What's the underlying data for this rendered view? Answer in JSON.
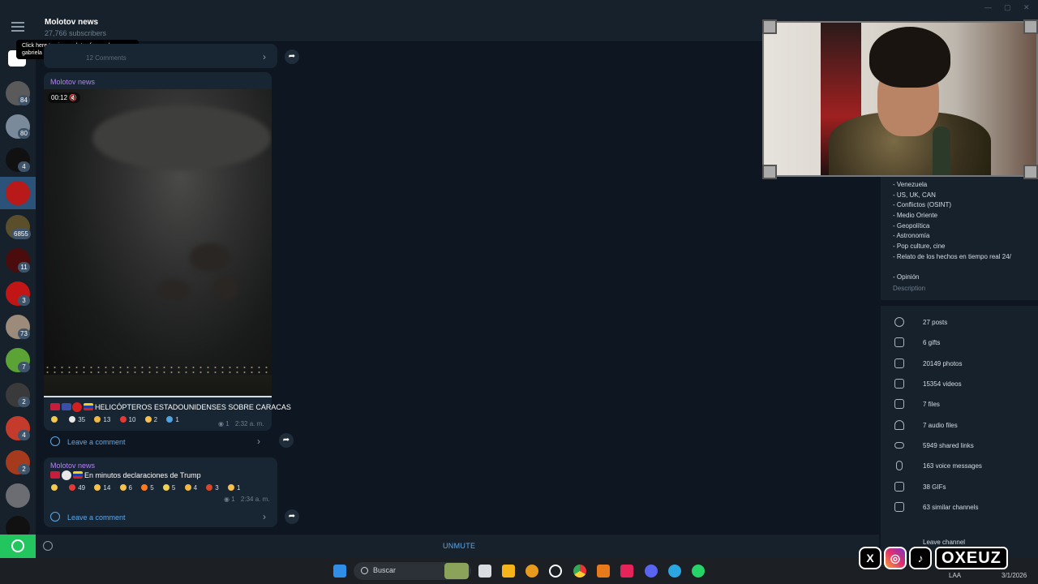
{
  "header": {
    "channel_name": "Molotov news",
    "subscribers": "27,766 subscribers"
  },
  "tooltip": {
    "text": "Click here to view updates from val, gabriela paola and Lesmen.",
    "close_icon": "close-icon"
  },
  "sidebar": {
    "badges": [
      "84",
      "80",
      "4",
      "6855",
      "11",
      "3",
      "73",
      "7",
      "2",
      "4",
      "2"
    ]
  },
  "messages": [
    {
      "comments_label": "12 Comments"
    },
    {
      "author": "Molotov news",
      "video_time": "00:12",
      "video_progress_percent": 100,
      "caption": "HELICÓPTEROS ESTADOUNIDENSES SOBRE CARACAS",
      "reactions": [
        {
          "icon": "star-icon",
          "count": ""
        },
        {
          "icon": "eyes-icon",
          "count": "35"
        },
        {
          "icon": "ghost-icon",
          "count": "13"
        },
        {
          "icon": "heart-icon",
          "count": "10"
        },
        {
          "icon": "clap-icon",
          "count": "2"
        },
        {
          "icon": "whale-icon",
          "count": "1"
        }
      ],
      "views": "1",
      "time": "2:32 a. m.",
      "comment_label": "Leave a comment"
    },
    {
      "author": "Molotov news",
      "text": "En minutos declaraciones de Trump",
      "reactions": [
        {
          "icon": "star-icon",
          "count": ""
        },
        {
          "icon": "heart-icon",
          "count": "49"
        },
        {
          "icon": "smile-icon",
          "count": "14"
        },
        {
          "icon": "cry-icon",
          "count": "6"
        },
        {
          "icon": "fire-icon",
          "count": "5"
        },
        {
          "icon": "party-icon",
          "count": "5"
        },
        {
          "icon": "scream-icon",
          "count": "4"
        },
        {
          "icon": "angry-icon",
          "count": "3"
        },
        {
          "icon": "thumbs-up-icon",
          "count": "1"
        }
      ],
      "views": "1",
      "time": "2:34 a. m.",
      "comment_label": "Leave a comment"
    }
  ],
  "bottombar": {
    "unmute_label": "UNMUTE"
  },
  "info_panel": {
    "description_lines": [
      "- Venezuela",
      "- US, UK, CAN",
      "- Conflictos (OSINT)",
      "- Medio Oriente",
      "- Geopolítica",
      "- Astronomía",
      "- Pop culture, cine",
      "- Relato de los hechos en tiempo real 24/",
      "",
      "- Opinión"
    ],
    "description_label": "Description",
    "stats": [
      {
        "icon": "posts-icon",
        "label": "27 posts"
      },
      {
        "icon": "gift-icon",
        "label": "6 gifts"
      },
      {
        "icon": "photo-icon",
        "label": "20149 photos"
      },
      {
        "icon": "video-icon",
        "label": "15354 videos"
      },
      {
        "icon": "file-icon",
        "label": "7 files"
      },
      {
        "icon": "headphones-icon",
        "label": "7 audio files"
      },
      {
        "icon": "link-icon",
        "label": "5949 shared links"
      },
      {
        "icon": "mic-icon",
        "label": "163 voice messages"
      },
      {
        "icon": "gif-icon",
        "label": "38 GIFs"
      },
      {
        "icon": "megaphone-icon",
        "label": "63 similar channels"
      }
    ],
    "leave_label": "Leave channel"
  },
  "taskbar": {
    "search_placeholder": "Buscar",
    "lang": "LAA",
    "date": "3/1/2026"
  },
  "overlay": {
    "brand_text": "OXEUZ"
  },
  "colors": {
    "chat_bg": "#0e1621",
    "panel_bg": "#17212b",
    "bubble_bg": "#182533",
    "accent": "#5fa8e8",
    "author": "#b384f0"
  }
}
